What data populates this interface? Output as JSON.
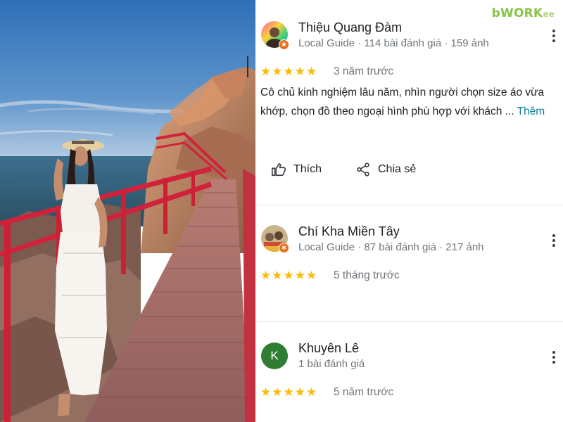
{
  "watermark": {
    "main": "bWORK",
    "tail": "ee"
  },
  "reviews": [
    {
      "name": "Thiệu Quang Đàm",
      "meta": "Local Guide · 114 bài đánh giá · 159 ảnh",
      "stars": "★★★★★",
      "time": "3 năm trước",
      "text": "Cô chủ kinh nghiệm lâu năm, nhìn người chọn size áo vừa khớp, chọn đồ theo ngoại hình phù hợp với khách",
      "ellipsis": "...",
      "more_label": "Thêm",
      "like_label": "Thích",
      "share_label": "Chia sẻ"
    },
    {
      "name": "Chí Kha Miền Tây",
      "meta": "Local Guide · 87 bài đánh giá · 217 ảnh",
      "stars": "★★★★★",
      "time": "5 tháng trước"
    },
    {
      "name": "Khuyên Lê",
      "avatar_letter": "K",
      "meta": "1 bài đánh giá",
      "stars": "★★★★★",
      "time": "5 năm trước"
    }
  ],
  "colors": {
    "star": "#fbbc04",
    "avatar_k": "#2e7d32",
    "guide_badge": "#e8711c",
    "watermark": "#8bc34a"
  },
  "icons": [
    "thumbs-up-icon",
    "share-icon",
    "more-vert-icon",
    "local-guide-badge-icon"
  ]
}
